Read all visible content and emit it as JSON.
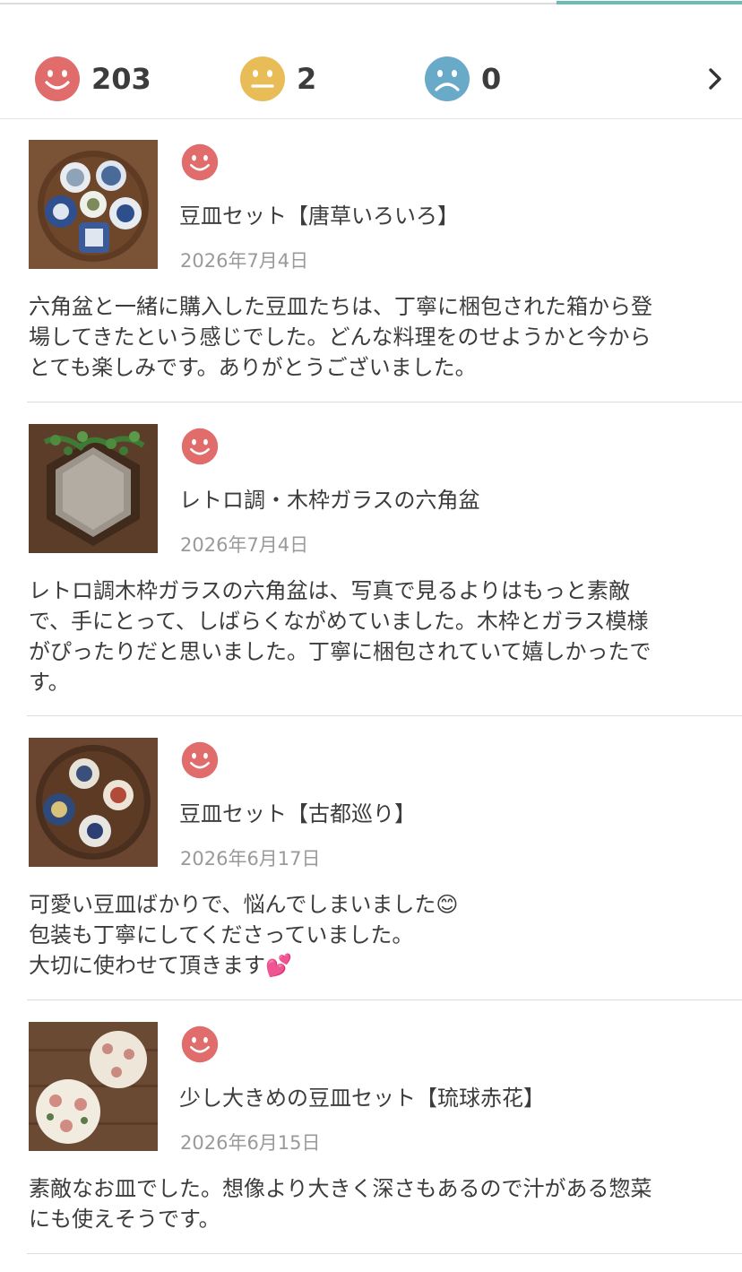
{
  "summary": {
    "positive_count": "203",
    "neutral_count": "2",
    "negative_count": "0"
  },
  "colors": {
    "positive": "#e06c6c",
    "neutral": "#e8bc57",
    "negative": "#6aaac9",
    "tab_accent": "#6bbcb8"
  },
  "reviews": [
    {
      "title": "豆皿セット【唐草いろいろ】",
      "date": "2026年7月4日",
      "body": [
        "六角盆と一緒に購入した豆皿たちは、丁寧に梱包された箱から登",
        "場してきたという感じでした。どんな料理をのせようかと今から",
        "とても楽しみです。ありがとうございました。"
      ]
    },
    {
      "title": "レトロ調・木枠ガラスの六角盆",
      "date": "2026年7月4日",
      "body": [
        "レトロ調木枠ガラスの六角盆は、写真で見るよりはもっと素敵",
        "で、手にとって、しばらくながめていました。木枠とガラス模様",
        "がぴったりだと思いました。丁寧に梱包されていて嬉しかったで",
        "す。"
      ]
    },
    {
      "title": "豆皿セット【古都巡り】",
      "date": "2026年6月17日",
      "body": [
        "可愛い豆皿ばかりで、悩んでしまいました😊",
        "包装も丁寧にしてくださっていました。",
        "大切に使わせて頂きます💕"
      ]
    },
    {
      "title": "少し大きめの豆皿セット【琉球赤花】",
      "date": "2026年6月15日",
      "body": [
        "素敵なお皿でした。想像より大きく深さもあるので汁がある惣菜",
        "にも使えそうです。"
      ]
    }
  ]
}
